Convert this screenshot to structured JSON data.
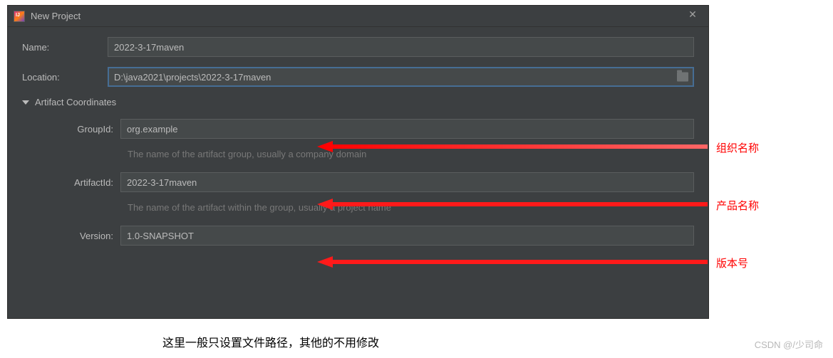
{
  "window": {
    "title": "New Project"
  },
  "form": {
    "name_label": "Name:",
    "name_value": "2022-3-17maven",
    "location_label": "Location:",
    "location_value": "D:\\java2021\\projects\\2022-3-17maven"
  },
  "section": {
    "title": "Artifact Coordinates"
  },
  "artifact": {
    "groupid_label": "GroupId:",
    "groupid_value": "org.example",
    "groupid_hint": "The name of the artifact group, usually a company domain",
    "artifactid_label": "ArtifactId:",
    "artifactid_value": "2022-3-17maven",
    "artifactid_hint": "The name of the artifact within the group, usually a project name",
    "version_label": "Version:",
    "version_value": "1.0-SNAPSHOT"
  },
  "annotations": {
    "groupid": "组织名称",
    "artifactid": "产品名称",
    "version": "版本号"
  },
  "caption": "这里一般只设置文件路径，其他的不用修改",
  "watermark": "CSDN @/少司命"
}
